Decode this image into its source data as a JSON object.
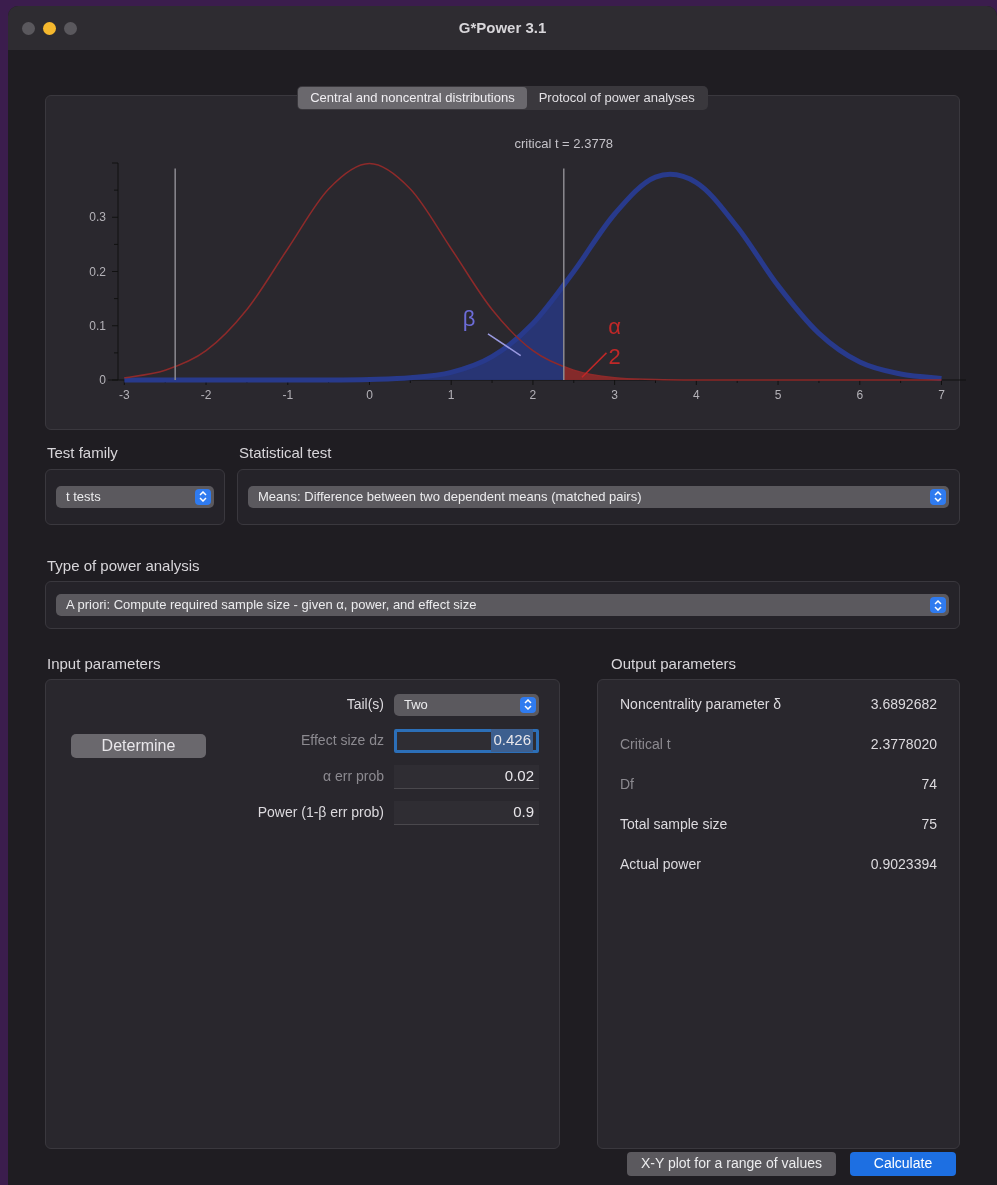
{
  "window": {
    "title": "G*Power 3.1"
  },
  "tabs": [
    {
      "label": "Central and noncentral distributions",
      "selected": true
    },
    {
      "label": "Protocol of power analyses",
      "selected": false
    }
  ],
  "chart": {
    "chart_data": {
      "type": "line",
      "title": "critical t = 2.3778",
      "x": [
        -3,
        -2.5,
        -2,
        -1.5,
        -1,
        -0.5,
        0,
        0.5,
        1,
        1.5,
        2,
        2.5,
        3,
        3.5,
        4,
        4.5,
        5,
        5.5,
        6,
        6.5,
        7
      ],
      "series": [
        {
          "color": "#8e2a2a",
          "values": [
            0.004,
            0.018,
            0.054,
            0.13,
            0.242,
            0.352,
            0.399,
            0.352,
            0.242,
            0.13,
            0.054,
            0.018,
            0.004,
            0.001,
            0,
            0,
            0,
            0,
            0,
            0,
            0
          ]
        },
        {
          "color": "#283a8c",
          "values": [
            0,
            0,
            0,
            0,
            0,
            0,
            0.001,
            0.004,
            0.014,
            0.043,
            0.104,
            0.2,
            0.306,
            0.374,
            0.364,
            0.282,
            0.174,
            0.086,
            0.033,
            0.011,
            0.003
          ]
        }
      ],
      "xlim": [
        -3.2,
        7.3
      ],
      "ylim": [
        0,
        0.4
      ],
      "xticks": [
        -3,
        -2,
        -1,
        0,
        1,
        2,
        3,
        4,
        5,
        6,
        7
      ],
      "yticks": [
        0,
        0.1,
        0.2,
        0.3
      ],
      "ref_lines": [
        {
          "axis": "x",
          "value": -2.3778
        },
        {
          "axis": "x",
          "value": 2.3778
        }
      ],
      "annotations": [
        "β",
        "α",
        "2"
      ]
    }
  },
  "test_family": {
    "label": "Test family",
    "value": "t tests"
  },
  "statistical_test": {
    "label": "Statistical test",
    "value": "Means: Difference between two dependent means (matched pairs)"
  },
  "type_of_power_analysis": {
    "label": "Type of power analysis",
    "value": "A priori: Compute required sample size - given α, power, and effect size"
  },
  "input_parameters": {
    "title": "Input parameters",
    "determine_button": "Determine",
    "fields": [
      {
        "kind": "dropdown",
        "label": "Tail(s)",
        "value": "Two",
        "dimmed": false,
        "focused": false
      },
      {
        "kind": "number",
        "label": "Effect size dz",
        "value": "0.426",
        "dimmed": true,
        "focused": true
      },
      {
        "kind": "number",
        "label": "α err prob",
        "value": "0.02",
        "dimmed": true,
        "focused": false
      },
      {
        "kind": "number",
        "label": "Power (1-β err prob)",
        "value": "0.9",
        "dimmed": false,
        "focused": false
      }
    ]
  },
  "output_parameters": {
    "title": "Output parameters",
    "rows": [
      {
        "label": "Noncentrality parameter δ",
        "value": "3.6892682",
        "dimmed": false
      },
      {
        "label": "Critical t",
        "value": "2.3778020",
        "dimmed": true
      },
      {
        "label": "Df",
        "value": "74",
        "dimmed": true
      },
      {
        "label": "Total sample size",
        "value": "75",
        "dimmed": false
      },
      {
        "label": "Actual power",
        "value": "0.9023394",
        "dimmed": false
      }
    ]
  },
  "buttons": [
    {
      "label": "X-Y plot for a range of values",
      "primary": false
    },
    {
      "label": "Calculate",
      "primary": true
    }
  ]
}
